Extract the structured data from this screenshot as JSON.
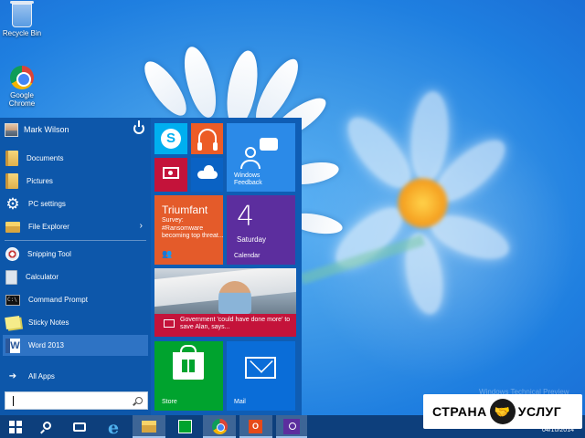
{
  "desktop": {
    "icons": [
      {
        "label": "Recycle Bin",
        "icon": "recycle-bin-icon"
      },
      {
        "label": "Google Chrome",
        "icon": "chrome-icon"
      }
    ],
    "watermark_text": "Windows Technical Preview"
  },
  "start_menu": {
    "user_name": "Mark Wilson",
    "places": [
      {
        "label": "Documents",
        "icon": "documents-folder-icon"
      },
      {
        "label": "Pictures",
        "icon": "pictures-folder-icon"
      },
      {
        "label": "PC settings",
        "icon": "gear-icon"
      },
      {
        "label": "File Explorer",
        "icon": "file-explorer-icon"
      }
    ],
    "apps": [
      {
        "label": "Snipping Tool",
        "icon": "snipping-tool-icon"
      },
      {
        "label": "Calculator",
        "icon": "calculator-icon"
      },
      {
        "label": "Command Prompt",
        "icon": "command-prompt-icon"
      },
      {
        "label": "Sticky Notes",
        "icon": "sticky-notes-icon"
      },
      {
        "label": "Word 2013",
        "icon": "word-icon"
      }
    ],
    "all_apps_label": "All Apps",
    "search_value": ""
  },
  "tiles": {
    "windows_feedback": "Windows Feedback",
    "money": {
      "title": "Triumfant",
      "body": "Survey: #Ransomware becoming top threat..."
    },
    "calendar": {
      "number": "4",
      "day": "Saturday",
      "label": "Calendar"
    },
    "news_caption": "Government 'could have done more' to save Alan, says...",
    "store": "Store",
    "mail": "Mail"
  },
  "taskbar": {
    "date": "04/10/2014",
    "items": [
      "start",
      "search",
      "task-view",
      "internet-explorer",
      "file-explorer",
      "store",
      "chrome",
      "office",
      "search-app"
    ]
  },
  "badge": {
    "left": "СТРАНА",
    "right": "УСЛУГ"
  },
  "colors": {
    "start_bg": "#0f5db4",
    "taskbar_bg": "#0d3f7c",
    "tile_skype": "#00aff0",
    "tile_music": "#ec5c26",
    "tile_photos": "#c4133a",
    "tile_calendar": "#5c2e9e",
    "tile_store": "#00a32e",
    "tile_mail": "#0a6dd8"
  }
}
